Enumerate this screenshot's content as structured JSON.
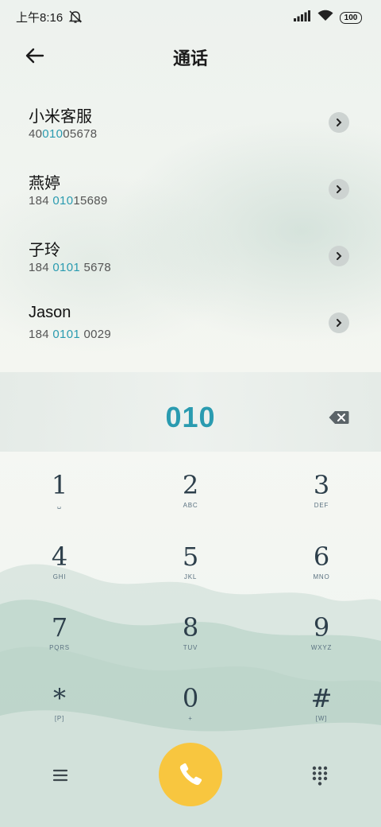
{
  "status": {
    "time": "上午8:16",
    "battery": "100"
  },
  "header": {
    "title": "通话"
  },
  "results": [
    {
      "name": "小米客服",
      "number_pre": "40",
      "number_match": "010",
      "number_post": "05678"
    },
    {
      "name": "燕婷",
      "number_pre": "184 ",
      "number_match": "010",
      "number_post": "15689"
    },
    {
      "name": "子玲",
      "number_pre": "184 ",
      "number_match": "0101",
      "number_post": " 5678"
    },
    {
      "name": "Jason",
      "number_pre": "184 ",
      "number_match": "0101",
      "number_post": " 0029"
    }
  ],
  "dial": {
    "number": "010"
  },
  "keypad": [
    {
      "digit": "1",
      "letters": "␣"
    },
    {
      "digit": "2",
      "letters": "ABC"
    },
    {
      "digit": "3",
      "letters": "DEF"
    },
    {
      "digit": "4",
      "letters": "GHI"
    },
    {
      "digit": "5",
      "letters": "JKL"
    },
    {
      "digit": "6",
      "letters": "MNO"
    },
    {
      "digit": "7",
      "letters": "PQRS"
    },
    {
      "digit": "8",
      "letters": "TUV"
    },
    {
      "digit": "9",
      "letters": "WXYZ"
    },
    {
      "digit": "*",
      "letters": "[P]"
    },
    {
      "digit": "0",
      "letters": "+"
    },
    {
      "digit": "#",
      "letters": "[W]"
    }
  ],
  "colors": {
    "accent": "#2a9bb0",
    "call_button": "#f8c63f"
  },
  "icons": {
    "status": [
      "mute-notification-icon",
      "signal-icon",
      "wifi-icon",
      "battery-icon"
    ],
    "back": "arrow-left-icon",
    "result_action": "chevron-right-icon",
    "delete": "backspace-icon",
    "menu": "hamburger-menu-icon",
    "call": "phone-icon",
    "keypad_toggle": "dialpad-icon"
  }
}
